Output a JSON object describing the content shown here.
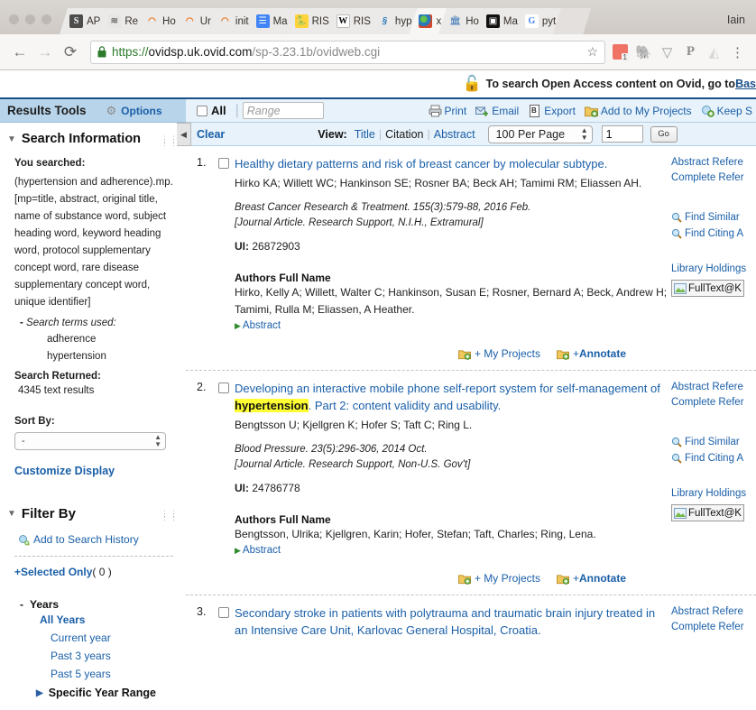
{
  "browser": {
    "profile_name": "Iain",
    "tabs": [
      {
        "label": "AP",
        "icon": "scholar-icon",
        "active": false
      },
      {
        "label": "Re",
        "icon": "scholar-alt-icon",
        "active": false
      },
      {
        "label": "Ho",
        "icon": "loading-spinner-icon",
        "active": false
      },
      {
        "label": "Ur",
        "icon": "loading-spinner-icon",
        "active": false
      },
      {
        "label": "init",
        "icon": "loading-spinner-icon",
        "active": false
      },
      {
        "label": "Ma",
        "icon": "google-docs-icon",
        "active": false
      },
      {
        "label": "RIS",
        "icon": "python-icon",
        "active": false
      },
      {
        "label": "RIS",
        "icon": "wikipedia-icon",
        "active": false
      },
      {
        "label": "hyp",
        "icon": "hypothesis-icon",
        "active": false
      },
      {
        "label": "x",
        "icon": "ovid-globe-icon",
        "active": true
      },
      {
        "label": "Ho",
        "icon": "library-icon",
        "active": false
      },
      {
        "label": "Ma",
        "icon": "black-square-icon",
        "active": false
      },
      {
        "label": "pyt",
        "icon": "google-icon",
        "active": false
      }
    ],
    "url": {
      "scheme": "https://",
      "domain": "ovidsp.uk.ovid.com",
      "path": "/sp-3.23.1b/ovidweb.cgi"
    },
    "extensions": [
      "calendar-icon",
      "evernote-icon",
      "pocket-icon",
      "pinterest-icon",
      "drive-icon",
      "chrome-menu-icon"
    ]
  },
  "oa_banner": {
    "text": "To search Open Access content on Ovid, go to ",
    "link_text": "Bas"
  },
  "sidebar": {
    "header": {
      "title": "Results Tools",
      "options_label": "Options"
    },
    "search_information": {
      "title": "Search Information",
      "you_searched_label": "You searched:",
      "query": "(hypertension and adherence).mp. [mp=title, abstract, original title, name of substance word, subject heading word, keyword heading word, protocol supplementary concept word, rare disease supplementary concept word, unique identifier]",
      "terms_used_label": "Search terms used:",
      "terms": [
        "adherence",
        "hypertension"
      ],
      "search_returned_label": "Search Returned:",
      "result_count": "4345 text results"
    },
    "sort_by": {
      "label": "Sort By:",
      "value": "-"
    },
    "customize_display": "Customize Display",
    "filter_by": {
      "title": "Filter By",
      "add_to_search_history": "Add to Search History",
      "selected_only": "+Selected Only",
      "selected_count": "( 0 )",
      "years": {
        "label": "Years",
        "all_years": "All Years",
        "options": [
          "Current year",
          "Past 3 years",
          "Past 5 years"
        ],
        "specific_year_range": "Specific Year Range"
      }
    }
  },
  "toolbar": {
    "all_label": "All",
    "range_placeholder": "Range",
    "actions": [
      {
        "label": "Print",
        "icon": "printer-icon"
      },
      {
        "label": "Email",
        "icon": "email-icon"
      },
      {
        "label": "Export",
        "icon": "export-icon"
      },
      {
        "label": "Add to My Projects",
        "icon": "add-project-icon"
      },
      {
        "label": "Keep S",
        "icon": "keep-selected-icon"
      }
    ]
  },
  "view_bar": {
    "clear_label": "Clear",
    "view_label": "View:",
    "view_options": [
      "Title",
      "Citation",
      "Abstract"
    ],
    "per_page_value": "100 Per Page",
    "page_value": "1",
    "go_label": "Go"
  },
  "results": [
    {
      "number": "1.",
      "title_parts": [
        {
          "text": "Healthy dietary patterns and risk of breast cancer by molecular subtype.",
          "highlight": false
        }
      ],
      "authors": "Hirko KA; Willett WC; Hankinson SE; Rosner BA; Beck AH; Tamimi RM; Eliassen AH.",
      "source": "Breast Cancer Research & Treatment. 155(3):579-88, 2016 Feb.",
      "pubtype": "[Journal Article. Research Support, N.I.H., Extramural]",
      "ui_label": "UI:",
      "ui_value": "26872903",
      "authors_full_head": "Authors Full Name",
      "authors_full": "Hirko, Kelly A; Willett, Walter C; Hankinson, Susan E; Rosner, Bernard A; Beck, Andrew H; Tamimi, Rulla M; Eliassen, A Heather.",
      "abstract_label": "Abstract",
      "actions": [
        {
          "label": "+ My Projects",
          "bold": false
        },
        {
          "label": "+ ",
          "bold": false
        },
        {
          "label": "Annotate",
          "bold": true
        }
      ],
      "right": {
        "abstract_reference": "Abstract Refere",
        "complete_reference": "Complete Refer",
        "find_similar": "Find Similar",
        "find_citing": "Find Citing A",
        "library_holdings": "Library Holdings",
        "fulltext": "FullText@K"
      }
    },
    {
      "number": "2.",
      "title_parts": [
        {
          "text": "Developing an interactive mobile phone self-report system for self-management of ",
          "highlight": false
        },
        {
          "text": "hypertension",
          "highlight": true
        },
        {
          "text": ". Part 2: content validity and usability.",
          "highlight": false
        }
      ],
      "authors": "Bengtsson U; Kjellgren K; Hofer S; Taft C; Ring L.",
      "source": "Blood Pressure. 23(5):296-306, 2014 Oct.",
      "pubtype": "[Journal Article. Research Support, Non-U.S. Gov't]",
      "ui_label": "UI:",
      "ui_value": "24786778",
      "authors_full_head": "Authors Full Name",
      "authors_full": "Bengtsson, Ulrika; Kjellgren, Karin; Hofer, Stefan; Taft, Charles; Ring, Lena.",
      "abstract_label": "Abstract",
      "actions": [
        {
          "label": "+ My Projects",
          "bold": false
        },
        {
          "label": "+ ",
          "bold": false
        },
        {
          "label": "Annotate",
          "bold": true
        }
      ],
      "right": {
        "abstract_reference": "Abstract Refere",
        "complete_reference": "Complete Refer",
        "find_similar": "Find Similar",
        "find_citing": "Find Citing A",
        "library_holdings": "Library Holdings",
        "fulltext": "FullText@K"
      }
    },
    {
      "number": "3.",
      "title_parts": [
        {
          "text": "Secondary stroke in patients with polytrauma and traumatic brain injury treated in an Intensive Care Unit, Karlovac General Hospital, Croatia.",
          "highlight": false
        }
      ],
      "right": {
        "abstract_reference": "Abstract Refere",
        "complete_reference": "Complete Refer"
      }
    }
  ],
  "colors": {
    "link": "#1a5fa8",
    "header_bg": "#b8d4ea",
    "toolbar_bg": "#e8f2fa",
    "highlight": "#ffff33",
    "accent_border": "#1a4f8a"
  }
}
